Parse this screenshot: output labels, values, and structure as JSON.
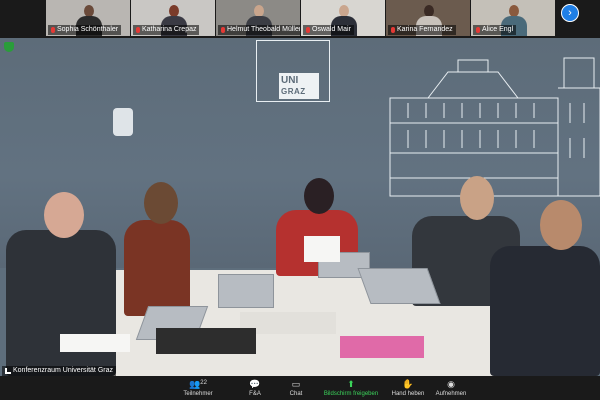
{
  "gallery": {
    "participants": [
      {
        "name": "Sophia Schönthaler",
        "muted": true
      },
      {
        "name": "Katharina Crepaz",
        "muted": true
      },
      {
        "name": "Helmut Theobald Müller",
        "muted": true
      },
      {
        "name": "Oswald Mair",
        "muted": true
      },
      {
        "name": "Karina Fernandez",
        "muted": true
      },
      {
        "name": "Alice Engl",
        "muted": true
      }
    ],
    "next_icon": "chevron-right-icon"
  },
  "main": {
    "room_name": "Konferenzraum Universität Graz",
    "logo": {
      "line1": "UNI",
      "line2": "GRAZ"
    }
  },
  "toolbar": {
    "participants_label": "Teilnehmer",
    "participants_count": "22",
    "qa_label": "F&A",
    "chat_label": "Chat",
    "share_label": "Bildschirm freigeben",
    "raise_hand_label": "Hand heben",
    "record_label": "Aufnehmen"
  },
  "colors": {
    "share_green": "#3bd35a",
    "accent_blue": "#1f7fe6",
    "muted_red": "#e53935"
  }
}
